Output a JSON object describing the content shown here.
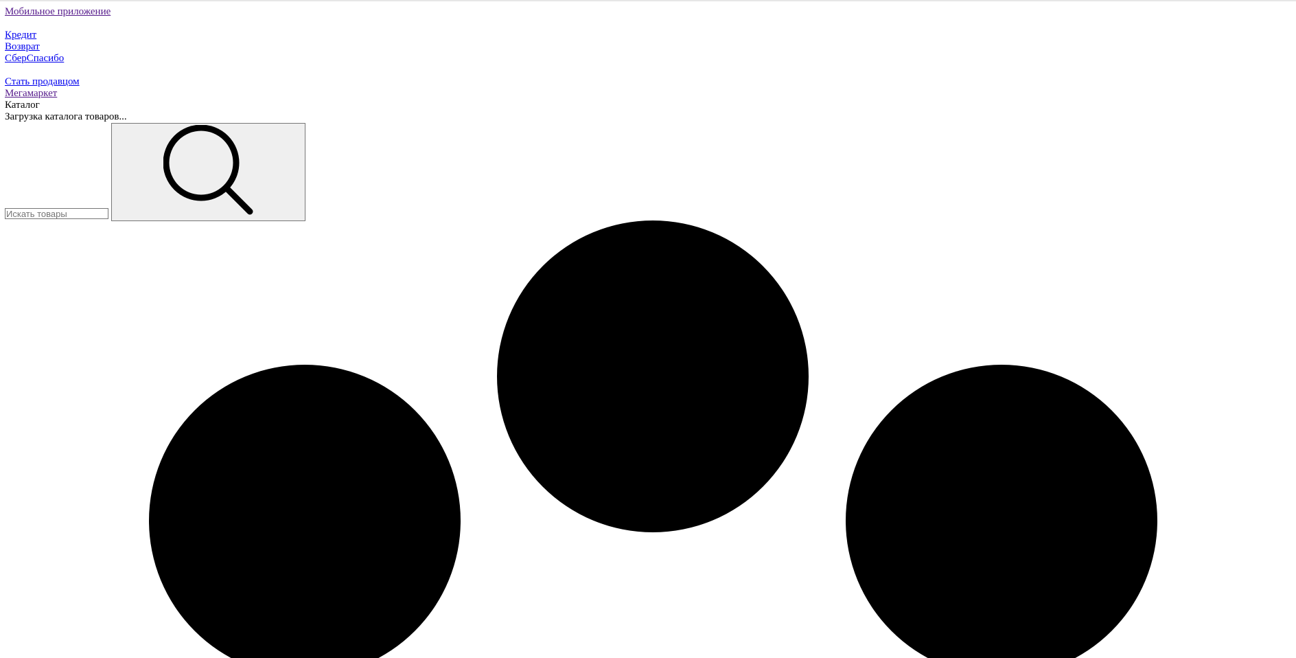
{
  "header": {
    "mobile_app_link": "Мобильное приложение"
  },
  "nav": {
    "credit_link": "Кредит",
    "return_link": "Возврат",
    "sberspasibo_link": "СберСпасибо"
  },
  "secondary_nav": {
    "become_seller_link": "Стать продавцом",
    "megamarket_link": "Мегамаркет",
    "catalog_label": "Каталог",
    "catalog_loading": "Загрузка каталога товаров..."
  },
  "search": {
    "placeholder": "Искать товары",
    "value": "",
    "button_icon": "search-icon"
  },
  "loader": {
    "icon": "loading-dots",
    "dot_count": 3,
    "dot_color": "#000000"
  },
  "colors": {
    "visited_link": "#551a8b",
    "unvisited_link": "#0000ee",
    "button_bg": "#efefef"
  }
}
